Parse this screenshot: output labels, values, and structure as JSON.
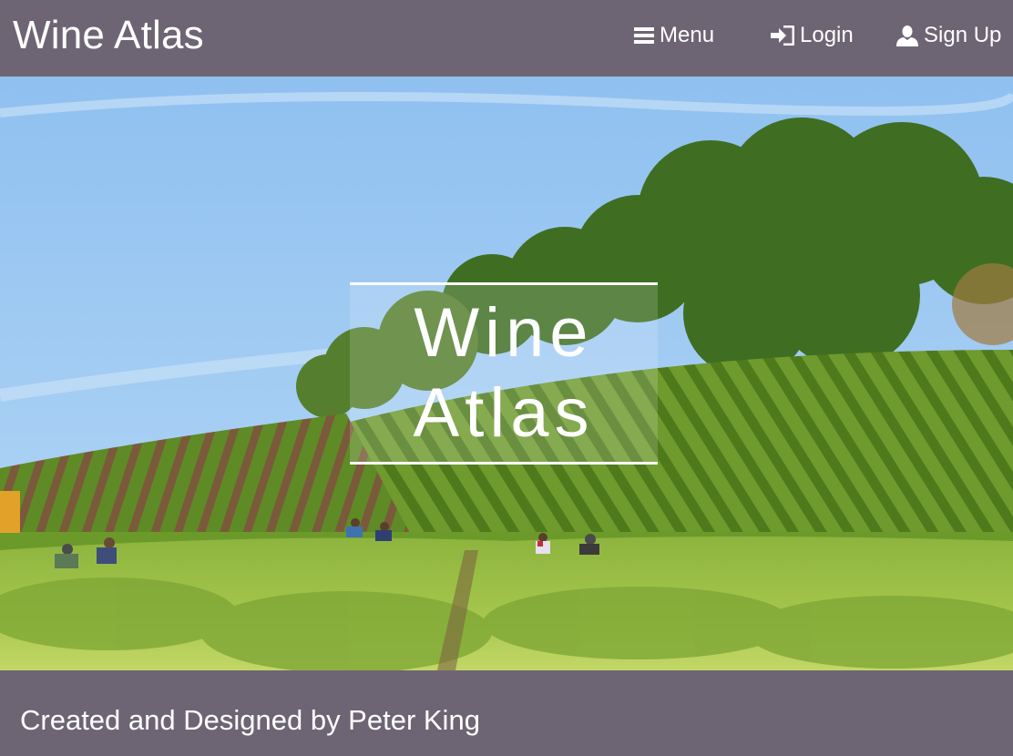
{
  "navbar": {
    "brand": "Wine Atlas",
    "menu_label": "Menu",
    "menu_icon": "hamburger-icon",
    "login_label": "Login",
    "login_icon": "login-arrow-icon",
    "signup_label": "Sign Up",
    "signup_icon": "user-icon"
  },
  "hero": {
    "title_line1": "Wine",
    "title_line2": "Atlas",
    "photo": "vineyard-harvest-photo"
  },
  "footer": {
    "credit": "Created and Designed by Peter King"
  },
  "colors": {
    "bar_background": "#6d6574",
    "text": "#ffffff",
    "sky": "#9cc8f2",
    "vines": "#6f9a2c"
  }
}
